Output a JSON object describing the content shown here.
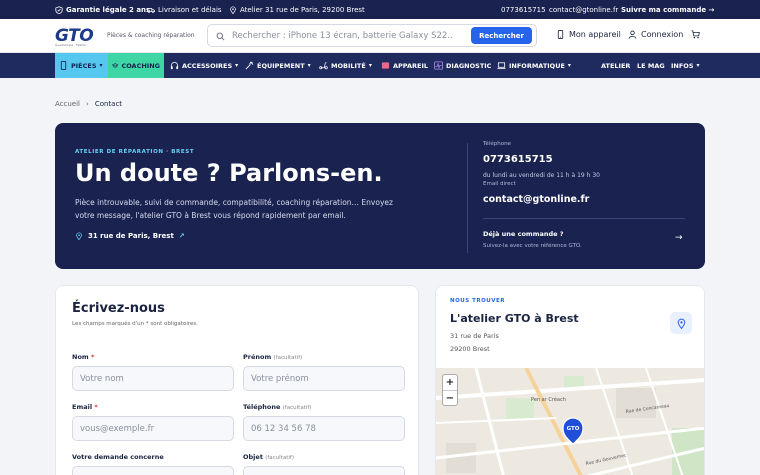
{
  "topbar": {
    "warranty": "Garantie légale 2 ans",
    "delivery": "Livraison et délais",
    "address": "Atelier 31 rue de Paris, 29200 Brest",
    "phone": "0773615715",
    "email": "contact@gtonline.fr",
    "track": "Suivre ma commande →"
  },
  "header": {
    "logo": "GTO",
    "logo_sub": "Guadeloupe · Mobile",
    "tagline": "Pièces & coaching réparation",
    "search_placeholder": "Rechercher : iPhone 13 écran, batterie Galaxy S22...",
    "search_button": "Rechercher",
    "my_device": "Mon appareil",
    "login": "Connexion"
  },
  "nav": {
    "items": [
      {
        "label": "PIÈCES",
        "chev": "▾"
      },
      {
        "label": "COACHING",
        "chev": ""
      },
      {
        "label": "ACCESSOIRES",
        "chev": "▾"
      },
      {
        "label": "ÉQUIPEMENT",
        "chev": "▾"
      },
      {
        "label": "MOBILITÉ",
        "chev": "▾"
      },
      {
        "label": "APPAREIL",
        "chev": ""
      },
      {
        "label": "DIAGNOSTIC",
        "chev": ""
      },
      {
        "label": "INFORMATIQUE",
        "chev": "▾"
      },
      {
        "label": "ATELIER",
        "chev": ""
      },
      {
        "label": "LE MAG",
        "chev": ""
      },
      {
        "label": "INFOS",
        "chev": "▾"
      }
    ]
  },
  "breadcrumb": {
    "home": "Accueil",
    "sep": "›",
    "current": "Contact"
  },
  "hero": {
    "eyebrow": "ATELIER DE RÉPARATION · BREST",
    "title": "Un doute ? Parlons-en.",
    "lead": "Pièce introuvable, suivi de commande, compatibilité, coaching réparation… Envoyez votre message, l'atelier GTO à Brest vous répond rapidement par email.",
    "address": "31 rue de Paris, Brest",
    "address_arrow": "↗",
    "phone_label": "Téléphone",
    "phone": "0773615715",
    "hours": "du lundi au vendredi de 11 h à 19 h 30",
    "email_label": "Email direct",
    "email": "contact@gtonline.fr",
    "order_title": "Déjà une commande ?",
    "order_sub": "Suivez-la avec votre référence GTO.",
    "order_arrow": "→"
  },
  "form": {
    "title": "Écrivez-nous",
    "required_note": "Les champs marqués d'un * sont obligatoires.",
    "name_label": "Nom",
    "name_placeholder": "Votre nom",
    "firstname_label": "Prénom",
    "firstname_placeholder": "Votre prénom",
    "email_label": "Email",
    "email_placeholder": "vous@exemple.fr",
    "phone_label": "Téléphone",
    "phone_placeholder": "06 12 34 56 78",
    "request_label": "Votre demande concerne",
    "subject_label": "Objet",
    "optional": "(facultatif)",
    "star": "*"
  },
  "map": {
    "eyebrow": "NOUS TROUVER",
    "title": "L'atelier GTO à Brest",
    "street": "31 rue de Paris",
    "city": "29200 Brest",
    "zoom_in": "+",
    "zoom_out": "−",
    "marker": "GTO",
    "street_label": "Pen ar Créach",
    "street_label_2": "Rue du Gouvernec",
    "street_label_3": "Rue de Concarneau"
  }
}
